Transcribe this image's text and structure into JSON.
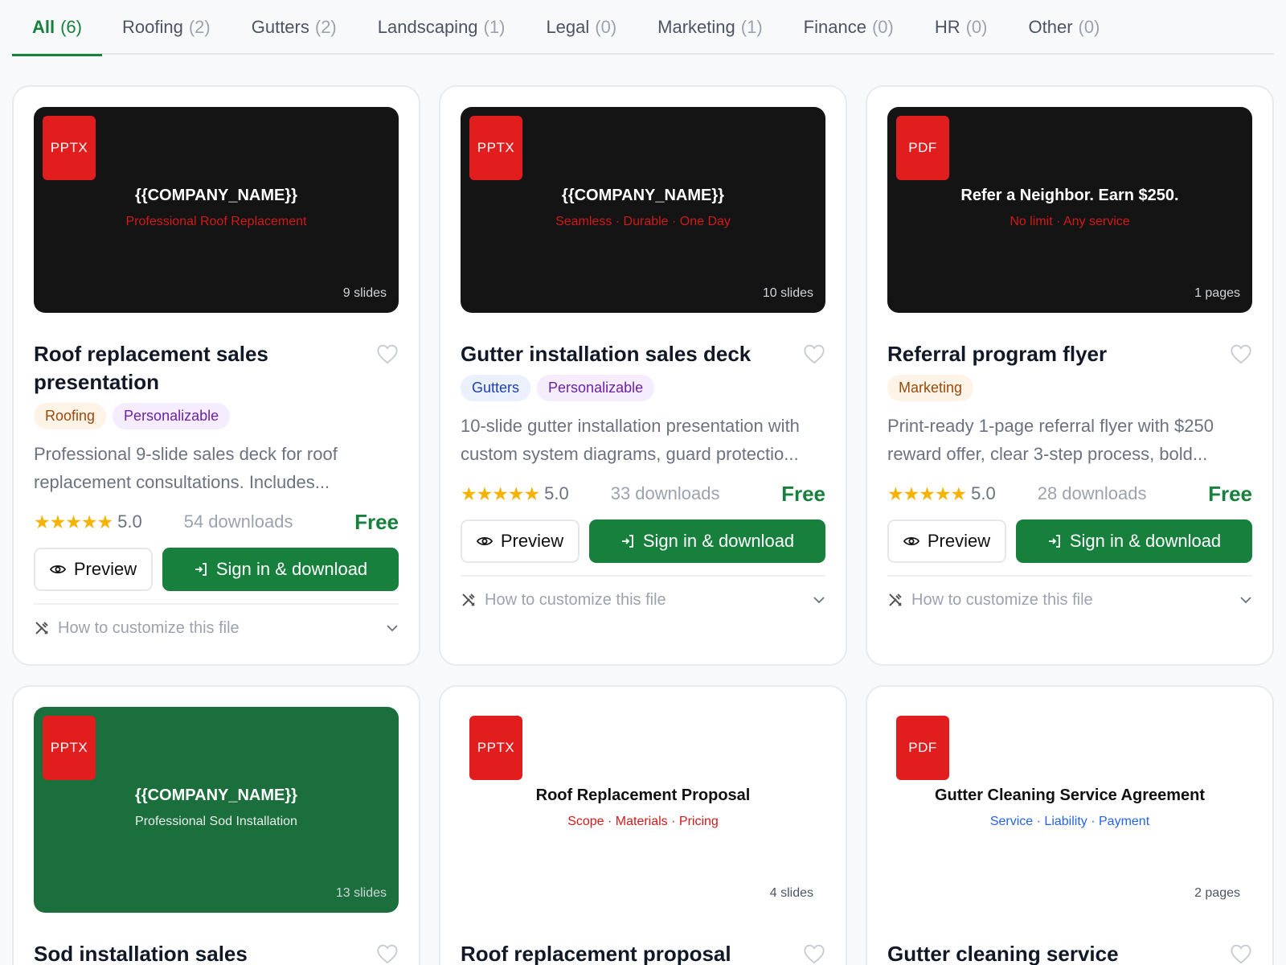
{
  "tabs": [
    {
      "label": "All",
      "count": "(6)",
      "active": true
    },
    {
      "label": "Roofing",
      "count": "(2)"
    },
    {
      "label": "Gutters",
      "count": "(2)"
    },
    {
      "label": "Landscaping",
      "count": "(1)"
    },
    {
      "label": "Legal",
      "count": "(0)"
    },
    {
      "label": "Marketing",
      "count": "(1)"
    },
    {
      "label": "Finance",
      "count": "(0)"
    },
    {
      "label": "HR",
      "count": "(0)"
    },
    {
      "label": "Other",
      "count": "(0)"
    }
  ],
  "buttons": {
    "preview": "Preview",
    "sign": "Sign in & download",
    "customize": "How to customize this file"
  },
  "stars_glyph": "★★★★★",
  "colors": {
    "accent": "#16803c",
    "file_badge": "#e11d1d",
    "star": "#f5b301"
  },
  "cards": [
    {
      "file_type": "PPTX",
      "thumb_title": "{{COMPANY_NAME}}",
      "thumb_subtitle": "Professional Roof Replacement",
      "thumb_count": "9 slides",
      "title": "Roof replacement sales presentation",
      "tags": [
        "Roofing",
        "Personalizable"
      ],
      "description": "Professional 9-slide sales deck for roof replacement consultations. Includes...",
      "rating": "5.0",
      "downloads": "54 downloads",
      "price": "Free"
    },
    {
      "file_type": "PPTX",
      "thumb_title": "{{COMPANY_NAME}}",
      "thumb_subtitle": "Seamless · Durable · One Day",
      "thumb_count": "10 slides",
      "title": "Gutter installation sales deck",
      "tags": [
        "Gutters",
        "Personalizable"
      ],
      "description": "10-slide gutter installation presentation with custom system diagrams, guard protectio...",
      "rating": "5.0",
      "downloads": "33 downloads",
      "price": "Free"
    },
    {
      "file_type": "PDF",
      "thumb_title": "Refer a Neighbor. Earn $250.",
      "thumb_subtitle": "No limit · Any service",
      "thumb_count": "1 pages",
      "title": "Referral program flyer",
      "tags": [
        "Marketing"
      ],
      "description": "Print-ready 1-page referral flyer with $250 reward offer, clear 3-step process, bold...",
      "rating": "5.0",
      "downloads": "28 downloads",
      "price": "Free"
    },
    {
      "file_type": "PPTX",
      "thumb_title": "{{COMPANY_NAME}}",
      "thumb_subtitle": "Professional Sod Installation",
      "thumb_count": "13 slides",
      "title": "Sod installation sales"
    },
    {
      "file_type": "PPTX",
      "thumb_title": "Roof Replacement Proposal",
      "thumb_subtitle": "Scope · Materials · Pricing",
      "thumb_count": "4 slides",
      "title": "Roof replacement proposal"
    },
    {
      "file_type": "PDF",
      "thumb_title": "Gutter Cleaning Service Agreement",
      "thumb_subtitle": "Service · Liability · Payment",
      "thumb_count": "2 pages",
      "title": "Gutter cleaning service"
    }
  ]
}
